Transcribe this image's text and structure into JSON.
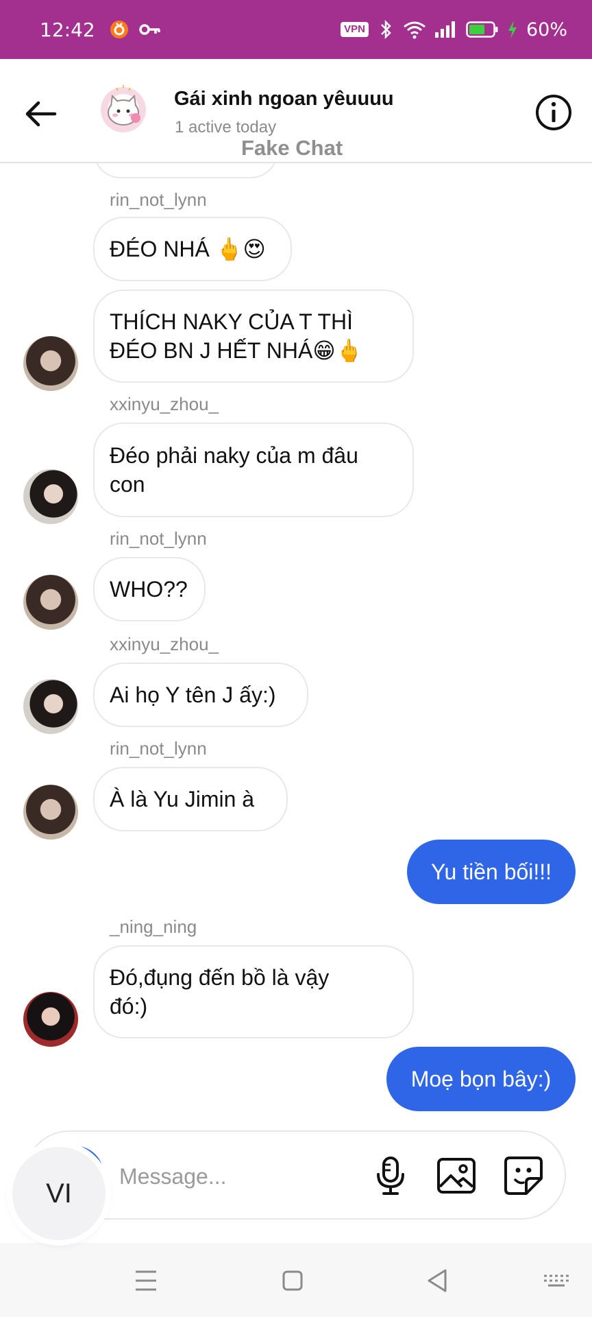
{
  "status_bar": {
    "time": "12:42",
    "vpn": "VPN",
    "battery": "60%"
  },
  "header": {
    "title": "Gái xinh ngoan yêuuuu",
    "subtitle": "1 active today",
    "watermark": "Fake Chat"
  },
  "messages": [
    {
      "sender": "rin_not_lynn",
      "text": "ĐÉO NHÁ 🖕😍"
    },
    {
      "text_line1": "THÍCH NAKY CỦA T THÌ",
      "text_line2": "ĐÉO BN J HẾT NHÁ😁🖕"
    },
    {
      "sender": "xxinyu_zhou_",
      "text_line1": "Đéo phải naky của m đâu",
      "text_line2": "con"
    },
    {
      "sender": "rin_not_lynn",
      "text": "WHO??"
    },
    {
      "sender": "xxinyu_zhou_",
      "text": "Ai họ Y tên J ấy:)"
    },
    {
      "sender": "rin_not_lynn",
      "text": "À là Yu Jimin à"
    },
    {
      "outgoing": true,
      "text": "Yu tiền bối!!!"
    },
    {
      "sender": "_ning_ning",
      "text_line1": "Đó,đụng đến bồ là vậy",
      "text_line2": "đó:)"
    },
    {
      "outgoing": true,
      "text": "Moẹ bọn bây:)"
    }
  ],
  "composer": {
    "placeholder": "Message..."
  },
  "ime_badge": "VI",
  "colors": {
    "status_bar": "#a3308f",
    "outgoing_bubble": "#2f66e8"
  }
}
